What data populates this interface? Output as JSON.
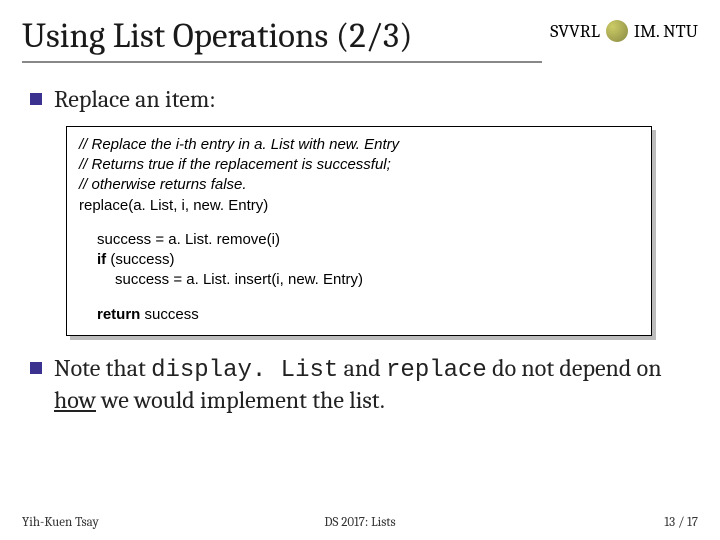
{
  "header": {
    "title": "Using List Operations (2/3)",
    "org_left": "SVVRL",
    "org_right": "IM. NTU"
  },
  "bullets": {
    "first": "Replace an item:",
    "second_pre": "Note that ",
    "second_code1": "display. List",
    "second_mid": " and ",
    "second_code2": "replace",
    "second_post": "  do not depend on ",
    "second_underline": "how",
    "second_tail": " we would implement the list."
  },
  "code": {
    "c1": "// Replace the i-th entry in a. List with new. Entry",
    "c2": "// Returns true if the replacement is successful;",
    "c3": "// otherwise returns false.",
    "l1": "replace(a. List, i, new. Entry)",
    "l2": "success = a. List. remove(i)",
    "l3_kw": "if",
    "l3_rest": " (success)",
    "l4": "success = a. List. insert(i, new. Entry)",
    "l5_kw": "return",
    "l5_rest": " success"
  },
  "footer": {
    "left": "Yih-Kuen Tsay",
    "center": "DS 2017: Lists",
    "page_current": "13",
    "page_sep": " / ",
    "page_total": "17"
  }
}
